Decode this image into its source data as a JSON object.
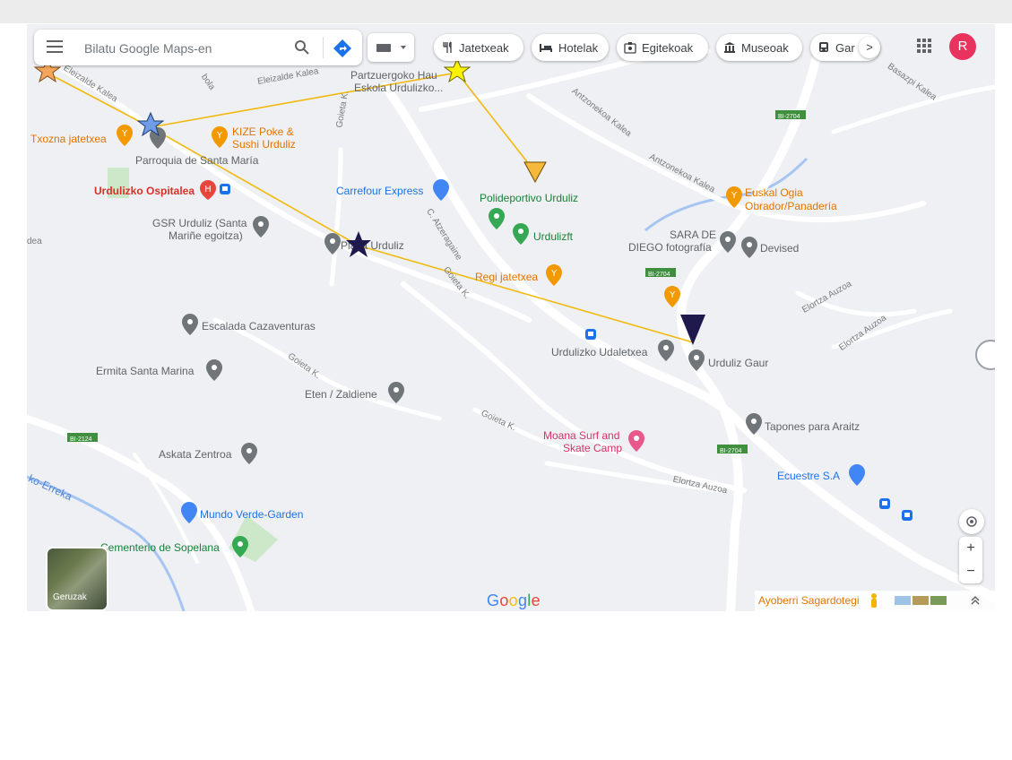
{
  "search": {
    "placeholder": "Bilatu Google Maps-en",
    "menu_icon": "hamburger-menu-icon",
    "search_icon": "search-icon",
    "directions_icon": "directions-icon"
  },
  "keyboard_icon": "keyboard-icon",
  "chips": [
    {
      "label": "Jatetxeak",
      "icon": "restaurant-icon"
    },
    {
      "label": "Hotelak",
      "icon": "hotel-icon"
    },
    {
      "label": "Egitekoak",
      "icon": "things-to-do-icon"
    },
    {
      "label": "Museoak",
      "icon": "museum-icon"
    },
    {
      "label": "Gar",
      "icon": "transit-icon"
    }
  ],
  "chips_more_label": ">",
  "account_initial": "R",
  "layers_label": "Geruzak",
  "google_logo": "Google",
  "bottom_place": "Ayoberri Sagardotegi",
  "colors": {
    "avatar": "#e8335f",
    "route": "#f2b90d",
    "marker_orange_star": "#f4a65a",
    "marker_blue_star": "#6f9ce6",
    "marker_yellow_star": "#fff200",
    "marker_orange_triangle": "#f6b93b",
    "marker_dark": "#1f1a4d"
  },
  "places": {
    "txozna": "Txozna jatetxea",
    "kize_1": "KIZE Poke &",
    "kize_2": "Sushi Urduliz",
    "parroquia": "Parroquia de Santa María",
    "ospitalea": "Urdulizko Ospitalea",
    "carrefour": "Carrefour Express",
    "polideportivo": "Polideportivo Urduliz",
    "urdulizft": "Urdulizft",
    "gsr_1": "GSR Urduliz (Santa",
    "gsr_2": "Mariñe egoitza)",
    "plaza": "Plaza Urduliz",
    "euskal_1": "Euskal Ogia",
    "euskal_2": "Obrador/Panadería",
    "sara_1": "SARA DE",
    "sara_2": "DIEGO fotografía",
    "devised": "Devised",
    "regi": "Regi jatetxea",
    "escalada": "Escalada Cazaventuras",
    "udaletxea": "Urdulizko Udaletxea",
    "gaur": "Urduliz Gaur",
    "ermita": "Ermita Santa Marina",
    "eten": "Eten / Zaldiene",
    "tapones": "Tapones para Araitz",
    "moana_1": "Moana Surf and",
    "moana_2": "Skate Camp",
    "askata": "Askata Zentroa",
    "ecuestre": "Ecuestre S.A",
    "mundo": "Mundo Verde-Garden",
    "cementerio": "Cementerio de Sopelana",
    "partzuergo_1": "Partzuergoko Hau",
    "partzuergo_2": "Eskola Urdulizko..."
  },
  "roads": {
    "eleizalde_kalea_1": "Eleizalde Kalea",
    "eleizalde_kalea_2": "Eleizalde Kalea",
    "goieta_k_1": "Goieta K.",
    "goieta_k_2": "Goieta K.",
    "goieta_k_3": "Goieta K.",
    "goieta_k_4": "Goieta K.",
    "antzoneko_1": "Antzonekoa Kalea",
    "antzoneko_2": "Antzonekoa Kalea",
    "c_atzeragaine": "C. Atzeragaine",
    "elortza_1": "Elortza Auzoa",
    "elortza_2": "Elortza Auzoa",
    "elortza_3": "Elortza Auzoa",
    "bi2704_1": "BI-2704",
    "bi2704_2": "BI-2704",
    "bi2704_3": "BI-2704",
    "bi2124": "BI-2124",
    "erreka": "ko-Erreka",
    "dea": "dea",
    "bola": "bola",
    "basazpi": "Basazpi Kalea"
  }
}
